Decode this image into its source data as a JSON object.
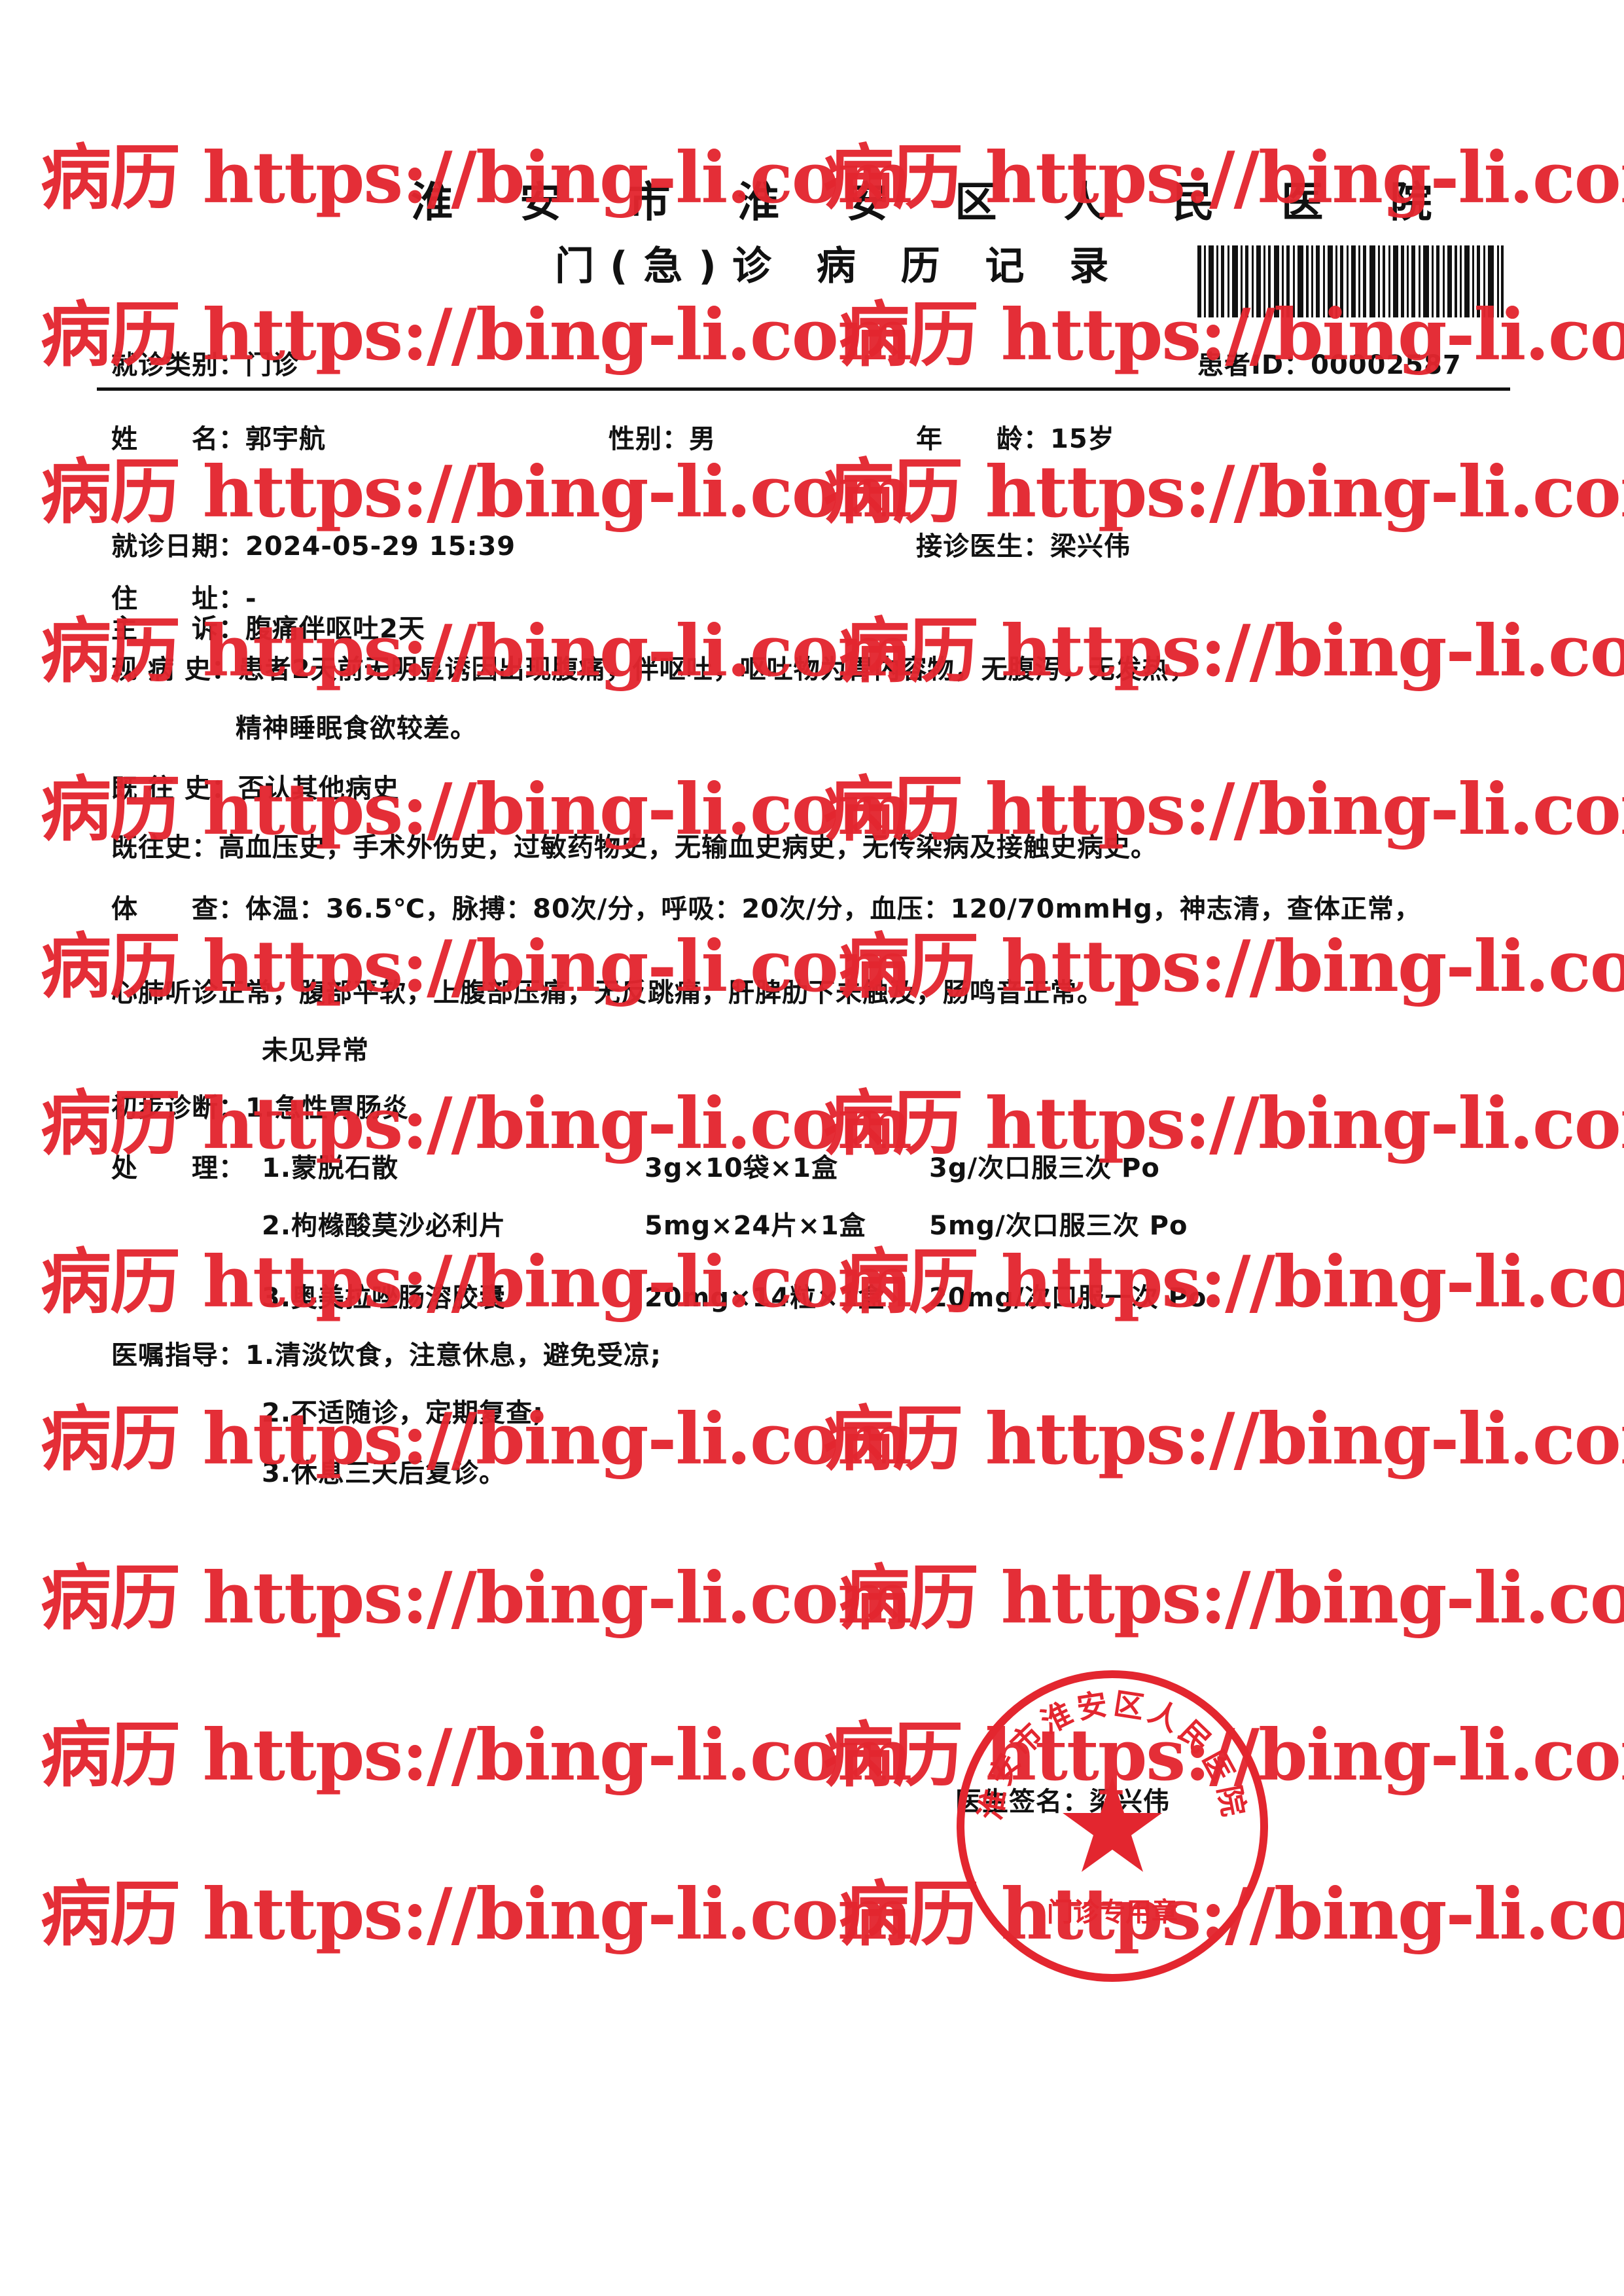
{
  "header": {
    "hospital": "淮 安 市 淮 安 区 人 民 医 院",
    "title": "门(急)诊 病 历 记 录",
    "visit_type_label": "就诊类别：",
    "visit_type": "门诊",
    "patient_id_label": "患者ID：",
    "patient_id": "00002587"
  },
  "patient": {
    "name_label": "姓　　名：",
    "name": "郭宇航",
    "sex_label": "性别：",
    "sex": "男",
    "age_label": "年　　龄：",
    "age": "15岁",
    "visit_date_label": "就诊日期：",
    "visit_date": "2024-05-29 15:39",
    "doctor_label": "接诊医生：",
    "doctor": "梁兴伟",
    "address_label": "住　　址：",
    "address": "-"
  },
  "record": {
    "chief_complaint": "主　　诉：腹痛伴呕吐2天",
    "present_illness_1": "现 病 史：患者2天前无明显诱因出现腹痛，伴呕吐，呕吐物为胃内容物，无腹泻，无发热，",
    "present_illness_2": "精神睡眠食欲较差。",
    "past_history_1": "既 往 史：否认其他病史",
    "past_history_2": "既往史：高血压史，手术外伤史，过敏药物史，无输血史病史，无传染病及接触史病史。",
    "exam_1": "体　　查：体温：36.5℃，脉搏：80次/分，呼吸：20次/分，血压：120/70mmHg，神志清，查体正常，",
    "exam_2": "心肺听诊正常，腹部平软，上腹部压痛，无反跳痛，肝脾肋下未触及，肠鸣音正常。",
    "exam_3": "未见异常",
    "diagnosis": "初步诊断：1.急性胃肠炎",
    "rx_label": "处　　理：",
    "rx_1_name": "1.蒙脱石散",
    "rx_1_dose": "3g×10袋×1盒",
    "rx_1_usage": "3g/次口服三次 Po",
    "rx_2_name": "2.枸橼酸莫沙必利片",
    "rx_2_dose": "5mg×24片×1盒",
    "rx_2_usage": "5mg/次口服三次 Po",
    "rx_3_name": "3.奥美拉唑肠溶胶囊",
    "rx_3_dose": "20mg×14粒×1盒",
    "rx_3_usage": "20mg/次口服一次 Po",
    "advice_1": "医嘱指导：1.清淡饮食，注意休息，避免受凉;",
    "advice_2": "2.不适随诊，定期复查;",
    "advice_3": "3.休息三天后复诊。",
    "signature_label": "医生签名：",
    "signature": "梁兴伟"
  },
  "seal": {
    "text": "淮安市淮安区人民医院",
    "subtext": "门诊专用章"
  },
  "watermark": {
    "text": "病历 https://bing-li.com",
    "color": "#e3262f"
  }
}
